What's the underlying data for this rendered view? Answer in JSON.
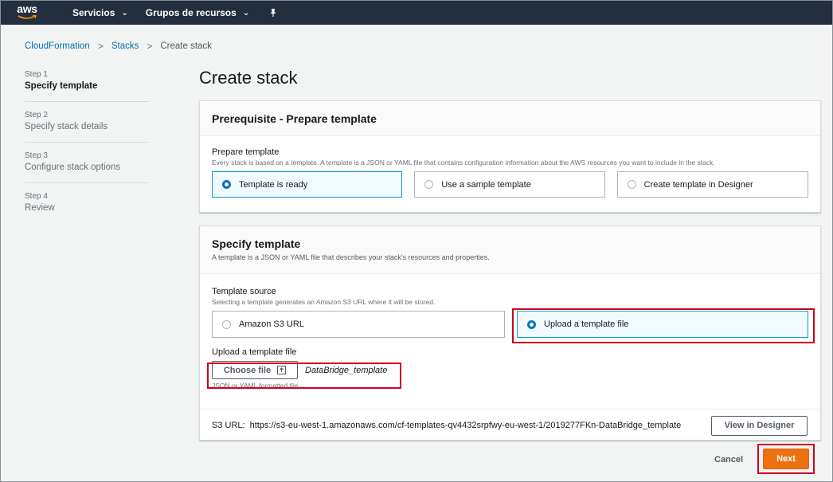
{
  "nav": {
    "logo": "aws",
    "items": [
      {
        "label": "Servicios"
      },
      {
        "label": "Grupos de recursos"
      }
    ],
    "pin_icon": "pin-icon"
  },
  "breadcrumb": [
    "CloudFormation",
    "Stacks",
    "Create stack"
  ],
  "steps": [
    {
      "num": "Step 1",
      "title": "Specify template"
    },
    {
      "num": "Step 2",
      "title": "Specify stack details"
    },
    {
      "num": "Step 3",
      "title": "Configure stack options"
    },
    {
      "num": "Step 4",
      "title": "Review"
    }
  ],
  "page_title": "Create stack",
  "prereq": {
    "title": "Prerequisite - Prepare template",
    "field_label": "Prepare template",
    "field_desc": "Every stack is based on a template. A template is a JSON or YAML file that contains configuration information about the AWS resources you want to include in the stack.",
    "options": [
      "Template is ready",
      "Use a sample template",
      "Create template in Designer"
    ],
    "selected": "Template is ready"
  },
  "specify": {
    "title": "Specify template",
    "desc": "A template is a JSON or YAML file that describes your stack's resources and properties.",
    "source_label": "Template source",
    "source_desc": "Selecting a template generates an Amazon S3 URL where it will be stored.",
    "options": [
      "Amazon S3 URL",
      "Upload a template file"
    ],
    "selected": "Upload a template file",
    "upload_label": "Upload a template file",
    "choose_file": "Choose file",
    "file_name": "DataBridge_template",
    "upload_hint": "JSON or YAML formatted file",
    "s3_label": "S3 URL:",
    "s3_url": "https://s3-eu-west-1.amazonaws.com/cf-templates-qv4432srpfwy-eu-west-1/2019277FKn-DataBridge_template",
    "view_designer": "View in Designer"
  },
  "footer": {
    "cancel": "Cancel",
    "next": "Next"
  },
  "colors": {
    "nav_bg": "#232f3e",
    "link": "#0073bb",
    "accent": "#ec7211",
    "highlight": "#d0021b"
  }
}
